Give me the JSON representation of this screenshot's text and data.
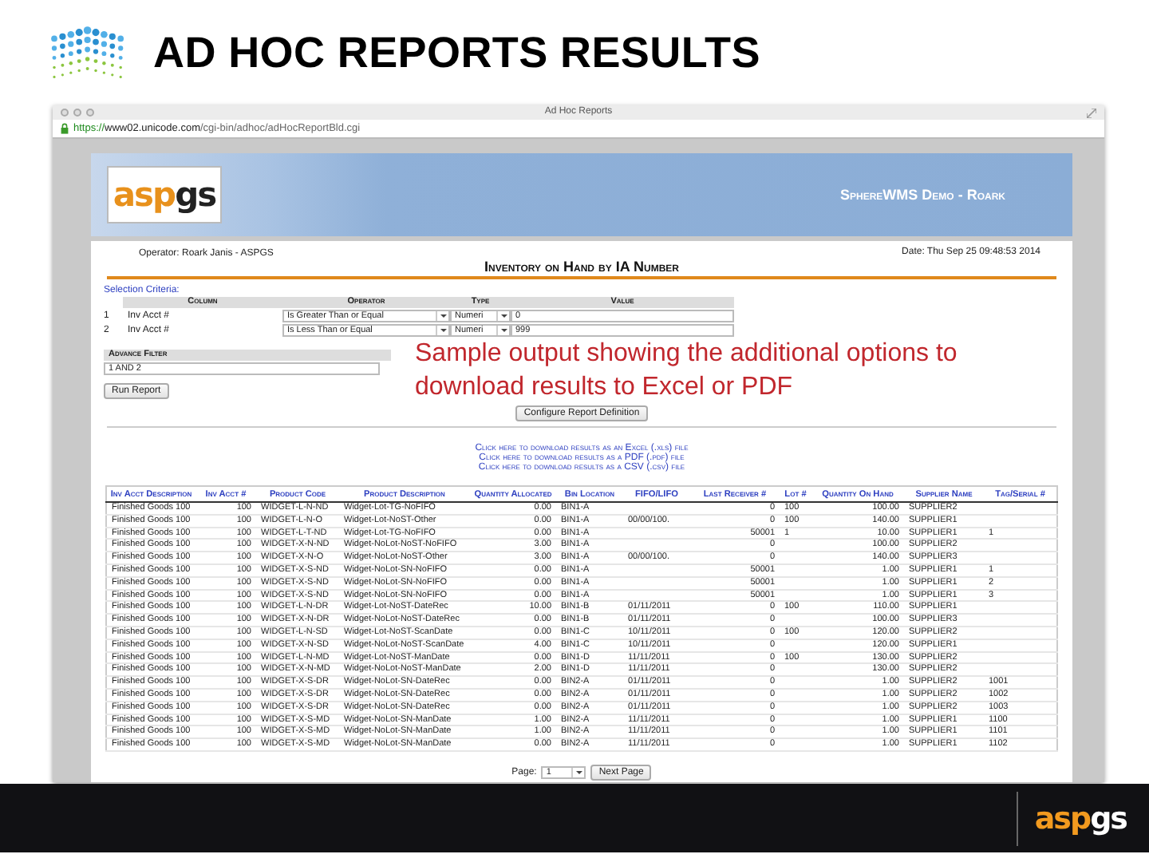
{
  "slide": {
    "title": "AD HOC REPORTS RESULTS"
  },
  "browser": {
    "title": "Ad Hoc Reports",
    "url_scheme": "https://",
    "url_host": "www02.unicode.com",
    "url_path": "/cgi-bin/adhoc/adHocReportBld.cgi"
  },
  "banner": {
    "logo": [
      "asp",
      "gs"
    ],
    "tagline": "SphereWMS Demo - Roark"
  },
  "report": {
    "operator": "Operator: Roark Janis - ASPGS",
    "title": "Inventory on Hand by IA Number",
    "date": "Date: Thu Sep 25 09:48:53 2014"
  },
  "criteria": {
    "label": "Selection Criteria:",
    "columns": [
      "Column",
      "Operator",
      "Type",
      "Value"
    ],
    "rows": [
      {
        "number": "1",
        "column": "Inv Acct #",
        "operator": "Is Greater Than or Equal",
        "type": "Numeri",
        "value": "0"
      },
      {
        "number": "2",
        "column": "Inv Acct #",
        "operator": "Is Less Than or Equal",
        "type": "Numeri",
        "value": "999"
      }
    ]
  },
  "advance_filter": {
    "label": "Advance Filter",
    "value": "1 AND 2"
  },
  "run_button": "Run Report",
  "annotation": "Sample output showing the additional options to download results to Excel or PDF",
  "configure_button": "Configure Report Definition",
  "download_links": [
    "Click here to download results as an Excel (.xls) file",
    "Click here to download results as a PDF (.pdf) file",
    "Click here to download results as a CSV (.csv) file"
  ],
  "table": {
    "columns": [
      "Inv Acct Description",
      "Inv Acct #",
      "Product Code",
      "Product Description",
      "Quantity Allocated",
      "Bin Location",
      "FIFO/LIFO",
      "Last Receiver #",
      "Lot #",
      "Quantity On Hand",
      "Supplier Name",
      "Tag/Serial #"
    ],
    "rows": [
      [
        "Finished Goods 100",
        "100",
        "WIDGET-L-N-ND",
        "Widget-Lot-TG-NoFIFO",
        "0.00",
        "BIN1-A",
        null,
        "0",
        "100",
        "100.00",
        "SUPPLIER2",
        null
      ],
      [
        "Finished Goods 100",
        "100",
        "WIDGET-L-N-O",
        "Widget-Lot-NoST-Other",
        "0.00",
        "BIN1-A",
        "00/00/100.",
        "0",
        "100",
        "140.00",
        "SUPPLIER1",
        null
      ],
      [
        "Finished Goods 100",
        "100",
        "WIDGET-L-T-ND",
        "Widget-Lot-TG-NoFIFO",
        "0.00",
        "BIN1-A",
        null,
        "50001",
        "1",
        "10.00",
        "SUPPLIER1",
        "1"
      ],
      [
        "Finished Goods 100",
        "100",
        "WIDGET-X-N-ND",
        "Widget-NoLot-NoST-NoFIFO",
        "3.00",
        "BIN1-A",
        null,
        "0",
        null,
        "100.00",
        "SUPPLIER2",
        null
      ],
      [
        "Finished Goods 100",
        "100",
        "WIDGET-X-N-O",
        "Widget-NoLot-NoST-Other",
        "3.00",
        "BIN1-A",
        "00/00/100.",
        "0",
        null,
        "140.00",
        "SUPPLIER3",
        null
      ],
      [
        "Finished Goods 100",
        "100",
        "WIDGET-X-S-ND",
        "Widget-NoLot-SN-NoFIFO",
        "0.00",
        "BIN1-A",
        null,
        "50001",
        null,
        "1.00",
        "SUPPLIER1",
        "1"
      ],
      [
        "Finished Goods 100",
        "100",
        "WIDGET-X-S-ND",
        "Widget-NoLot-SN-NoFIFO",
        "0.00",
        "BIN1-A",
        null,
        "50001",
        null,
        "1.00",
        "SUPPLIER1",
        "2"
      ],
      [
        "Finished Goods 100",
        "100",
        "WIDGET-X-S-ND",
        "Widget-NoLot-SN-NoFIFO",
        "0.00",
        "BIN1-A",
        null,
        "50001",
        null,
        "1.00",
        "SUPPLIER1",
        "3"
      ],
      [
        "Finished Goods 100",
        "100",
        "WIDGET-L-N-DR",
        "Widget-Lot-NoST-DateRec",
        "10.00",
        "BIN1-B",
        "01/11/2011",
        "0",
        "100",
        "110.00",
        "SUPPLIER1",
        null
      ],
      [
        "Finished Goods 100",
        "100",
        "WIDGET-X-N-DR",
        "Widget-NoLot-NoST-DateRec",
        "0.00",
        "BIN1-B",
        "01/11/2011",
        "0",
        null,
        "100.00",
        "SUPPLIER3",
        null
      ],
      [
        "Finished Goods 100",
        "100",
        "WIDGET-L-N-SD",
        "Widget-Lot-NoST-ScanDate",
        "0.00",
        "BIN1-C",
        "10/11/2011",
        "0",
        "100",
        "120.00",
        "SUPPLIER2",
        null
      ],
      [
        "Finished Goods 100",
        "100",
        "WIDGET-X-N-SD",
        "Widget-NoLot-NoST-ScanDate",
        "4.00",
        "BIN1-C",
        "10/11/2011",
        "0",
        null,
        "120.00",
        "SUPPLIER1",
        null
      ],
      [
        "Finished Goods 100",
        "100",
        "WIDGET-L-N-MD",
        "Widget-Lot-NoST-ManDate",
        "0.00",
        "BIN1-D",
        "11/11/2011",
        "0",
        "100",
        "130.00",
        "SUPPLIER2",
        null
      ],
      [
        "Finished Goods 100",
        "100",
        "WIDGET-X-N-MD",
        "Widget-NoLot-NoST-ManDate",
        "2.00",
        "BIN1-D",
        "11/11/2011",
        "0",
        null,
        "130.00",
        "SUPPLIER2",
        null
      ],
      [
        "Finished Goods 100",
        "100",
        "WIDGET-X-S-DR",
        "Widget-NoLot-SN-DateRec",
        "0.00",
        "BIN2-A",
        "01/11/2011",
        "0",
        null,
        "1.00",
        "SUPPLIER2",
        "1001"
      ],
      [
        "Finished Goods 100",
        "100",
        "WIDGET-X-S-DR",
        "Widget-NoLot-SN-DateRec",
        "0.00",
        "BIN2-A",
        "01/11/2011",
        "0",
        null,
        "1.00",
        "SUPPLIER2",
        "1002"
      ],
      [
        "Finished Goods 100",
        "100",
        "WIDGET-X-S-DR",
        "Widget-NoLot-SN-DateRec",
        "0.00",
        "BIN2-A",
        "01/11/2011",
        "0",
        null,
        "1.00",
        "SUPPLIER2",
        "1003"
      ],
      [
        "Finished Goods 100",
        "100",
        "WIDGET-X-S-MD",
        "Widget-NoLot-SN-ManDate",
        "1.00",
        "BIN2-A",
        "11/11/2011",
        "0",
        null,
        "1.00",
        "SUPPLIER1",
        "1100"
      ],
      [
        "Finished Goods 100",
        "100",
        "WIDGET-X-S-MD",
        "Widget-NoLot-SN-ManDate",
        "1.00",
        "BIN2-A",
        "11/11/2011",
        "0",
        null,
        "1.00",
        "SUPPLIER1",
        "1101"
      ],
      [
        "Finished Goods 100",
        "100",
        "WIDGET-X-S-MD",
        "Widget-NoLot-SN-ManDate",
        "0.00",
        "BIN2-A",
        "11/11/2011",
        "0",
        null,
        "1.00",
        "SUPPLIER1",
        "1102"
      ]
    ]
  },
  "pager": {
    "label": "Page:",
    "value": "1",
    "next": "Next Page"
  },
  "footer": {
    "logo": [
      "asp",
      "gs"
    ]
  }
}
